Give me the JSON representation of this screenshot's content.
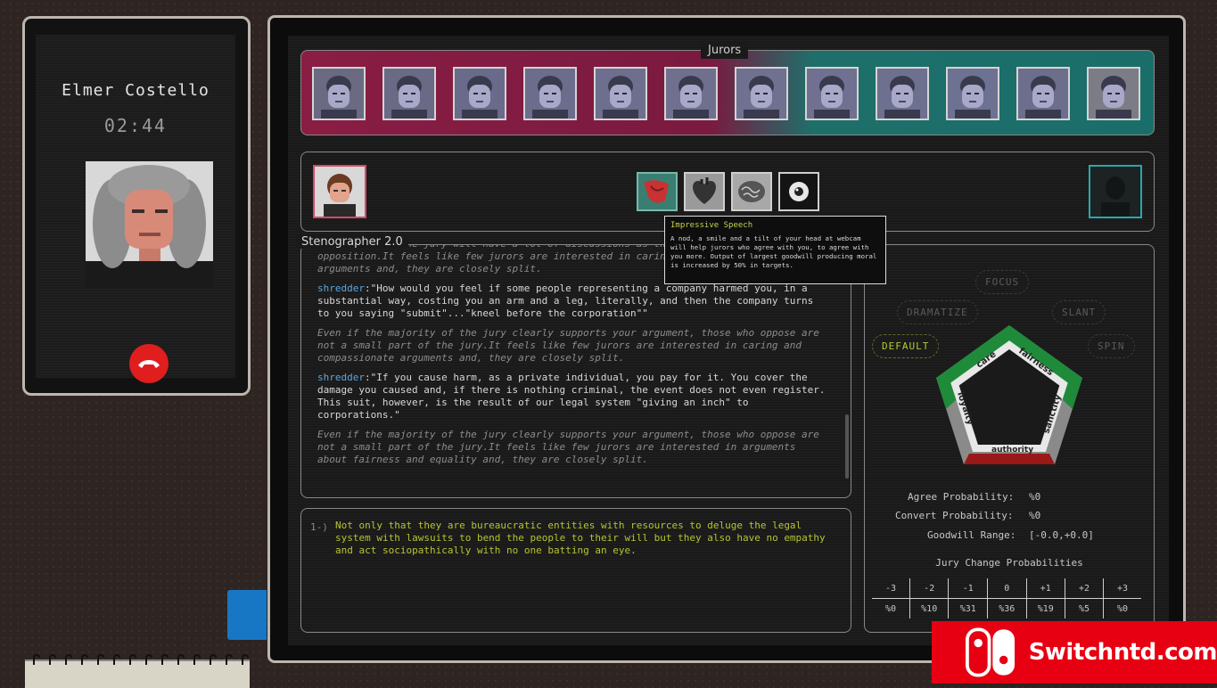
{
  "phone": {
    "caller_name": "Elmer Costello",
    "timer": "02:44"
  },
  "jurors": {
    "title": "Jurors",
    "count": 12
  },
  "skills": [
    {
      "name": "tongue-icon"
    },
    {
      "name": "heart-icon"
    },
    {
      "name": "brain-icon"
    },
    {
      "name": "eye-icon"
    }
  ],
  "tooltip": {
    "title": "Impressive Speech",
    "text": "A nod, a smile and a tilt of your head at webcam will help jurors who agree with you, to agree with you more. Output of largest goodwill producing moral is increased by 50% in targets."
  },
  "steno": {
    "title": "Stenographer 2.0",
    "entries": [
      {
        "type": "fb",
        "text": "It looks like the jury will have a lot of discussions as there are both supporters and opposition.It feels like few jurors are interested in caring and compassionate arguments and, they are closely split."
      },
      {
        "type": "sp",
        "speaker": "shredder",
        "text": ":\"How would you feel if some people representing a company harmed you, in a substantial way, costing you an arm and a leg, literally, and then the company turns to you saying \"submit\"...\"kneel before the corporation\"\""
      },
      {
        "type": "fb",
        "text": "Even if the majority of the jury clearly supports your argument, those who oppose are not a small part of the jury.It feels like few jurors are interested in caring and compassionate arguments and, they are closely split."
      },
      {
        "type": "sp",
        "speaker": "shredder",
        "text": ":\"If you cause harm, as a private individual, you pay for it. You cover the damage you caused and, if there is nothing criminal, the event does not even register. This suit, however, is the result of our legal system \"giving an inch\" to corporations.\""
      },
      {
        "type": "fb",
        "text": "Even if the majority of the jury clearly supports your argument, those who oppose are not a small part of the jury.It feels like few jurors are interested in arguments about fairness and equality and, they are closely split."
      }
    ]
  },
  "argument": {
    "index": "1-)",
    "text": "Not only that they are bureaucratic entities with resources to deluge the legal system with lawsuits to bend the people to their will but they also have no empathy and act sociopathically with no one batting an eye."
  },
  "modes": {
    "focus": "FOCUS",
    "dramatize": "DRAMATIZE",
    "slant": "SLANT",
    "default": "DEFAULT",
    "spin": "SPIN"
  },
  "morals": {
    "care": "care",
    "fairness": "fairness",
    "loyalty": "loyalty",
    "sanctity": "sanctity",
    "authority": "authority",
    "colors": {
      "positive": "#1f8a3a",
      "negative": "#9a1818",
      "neutral": "#8a8a8a"
    }
  },
  "stats": {
    "agree_label": "Agree Probability:",
    "agree_value": "%0",
    "convert_label": "Convert Probability:",
    "convert_value": "%0",
    "goodwill_label": "Goodwill Range:",
    "goodwill_value": "[-0.0,+0.0]",
    "jury_change_title": "Jury Change Probabilities",
    "headers": [
      "-3",
      "-2",
      "-1",
      "0",
      "+1",
      "+2",
      "+3"
    ],
    "values": [
      "%0",
      "%10",
      "%31",
      "%36",
      "%19",
      "%5",
      "%0"
    ]
  },
  "watermark": {
    "text": "Switchntd.com"
  }
}
